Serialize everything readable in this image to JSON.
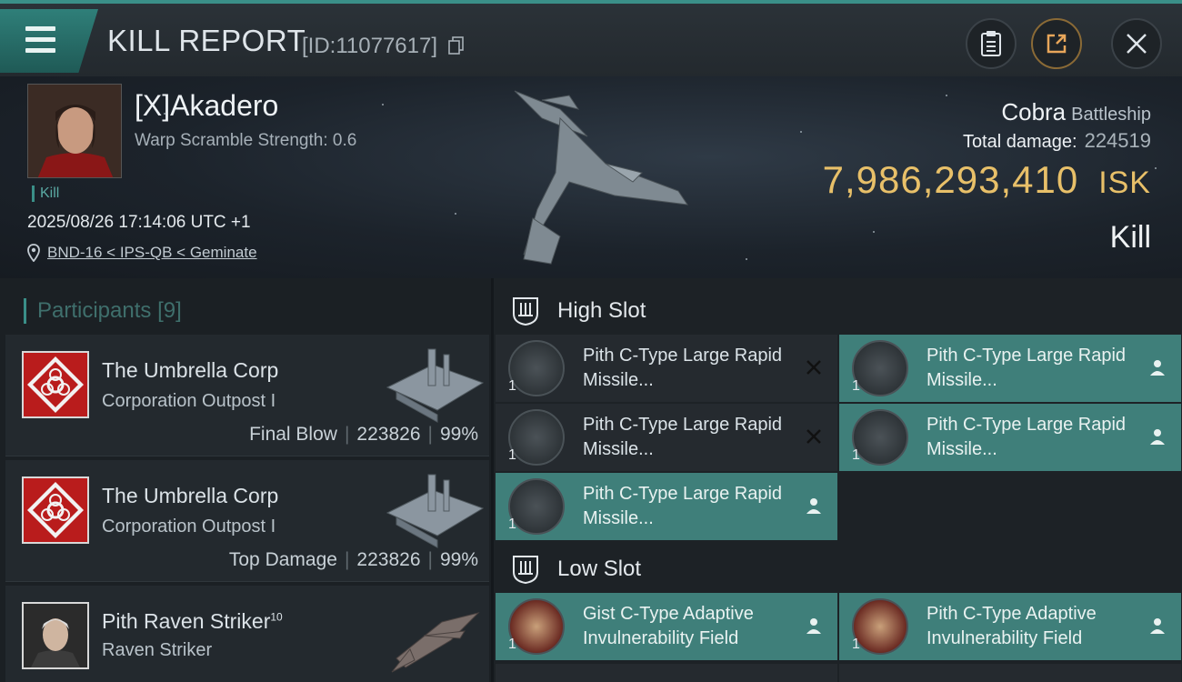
{
  "header": {
    "title": "KILL REPORT",
    "report_id": "[ID:11077617]"
  },
  "victim": {
    "name": "[X]Akadero",
    "warp_scramble": "Warp Scramble Strength: 0.6",
    "tag": "Kill",
    "timestamp": "2025/08/26 17:14:06 UTC +1",
    "location": "BND-16 < IPS-QB < Geminate",
    "ship_name": "Cobra",
    "ship_class": "Battleship",
    "total_damage_label": "Total damage:",
    "total_damage": "224519",
    "isk_value": "7,986,293,410",
    "isk_unit": "ISK",
    "result": "Kill"
  },
  "participants": {
    "label": "Participants",
    "count": "[9]",
    "items": [
      {
        "name": "The Umbrella Corp",
        "ship": "Corporation Outpost I",
        "role": "Final Blow",
        "damage": "223826",
        "percent": "99%"
      },
      {
        "name": "The Umbrella Corp",
        "ship": "Corporation Outpost I",
        "role": "Top Damage",
        "damage": "223826",
        "percent": "99%"
      },
      {
        "name": "Pith Raven Striker",
        "level": "10",
        "ship": "Raven Striker"
      }
    ]
  },
  "fitting": {
    "high_slot_label": "High Slot",
    "low_slot_label": "Low Slot",
    "high": [
      {
        "name": "Pith C-Type Large Rapid Missile...",
        "qty": "1",
        "status": "destroyed"
      },
      {
        "name": "Pith C-Type Large Rapid Missile...",
        "qty": "1",
        "status": "dropped"
      },
      {
        "name": "Pith C-Type Large Rapid Missile...",
        "qty": "1",
        "status": "destroyed"
      },
      {
        "name": "Pith C-Type Large Rapid Missile...",
        "qty": "1",
        "status": "dropped"
      },
      {
        "name": "Pith C-Type Large Rapid Missile...",
        "qty": "1",
        "status": "dropped"
      }
    ],
    "low": [
      {
        "name": "Gist C-Type Adaptive Invulnerability Field",
        "qty": "1",
        "status": "dropped"
      },
      {
        "name": "Pith C-Type Adaptive Invulnerability Field",
        "qty": "1",
        "status": "dropped"
      }
    ]
  },
  "colors": {
    "accent": "#3a8f88",
    "isk": "#e8c069",
    "fitted_module": "#3f7f7a"
  },
  "icons": [
    "menu-icon",
    "copy-icon",
    "clipboard-icon",
    "share-icon",
    "close-icon",
    "location-pin-icon",
    "high-slot-icon",
    "low-slot-icon",
    "destroyed-x-icon",
    "person-icon"
  ]
}
